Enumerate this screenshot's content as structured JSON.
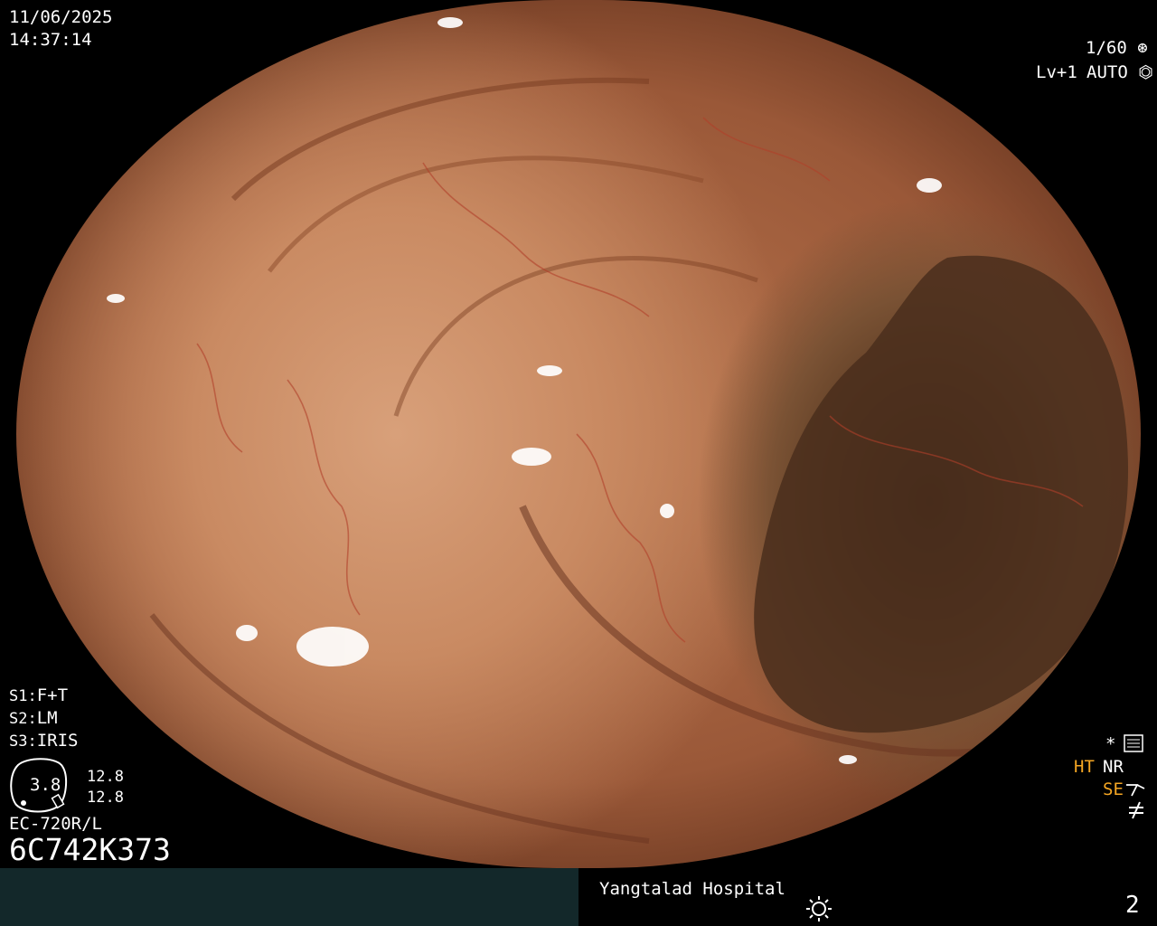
{
  "top_left": {
    "date": "11/06/2025",
    "time": "14:37:14"
  },
  "top_right": {
    "shutter": "1/60",
    "shutter_icon": "shutter-icon",
    "level": "Lv+1",
    "mode": "AUTO",
    "mode_icon": "iris-icon"
  },
  "settings": {
    "s1_key": "S1:",
    "s1_val": "F+T",
    "s2_key": "S2:",
    "s2_val": "LM",
    "s3_key": "S3:",
    "s3_val": "IRIS"
  },
  "gauge": {
    "value": "3.8",
    "upper": "12.8",
    "lower": "12.8"
  },
  "scope_model": "EC-720R/L",
  "serial": "6C742K373",
  "right_indicators": {
    "asterisk": "*",
    "ht": "HT",
    "nr": "NR",
    "se": "SE",
    "icons": [
      "menu-list-icon",
      "structure-enhance-icon",
      "not-equal-icon"
    ]
  },
  "footer": {
    "hospital": "Yangtalad Hospital",
    "brightness_icon": "sun-icon",
    "page_number": "2"
  },
  "colors": {
    "indicator_orange": "#f5a623",
    "footer_bg": "#13282a"
  }
}
